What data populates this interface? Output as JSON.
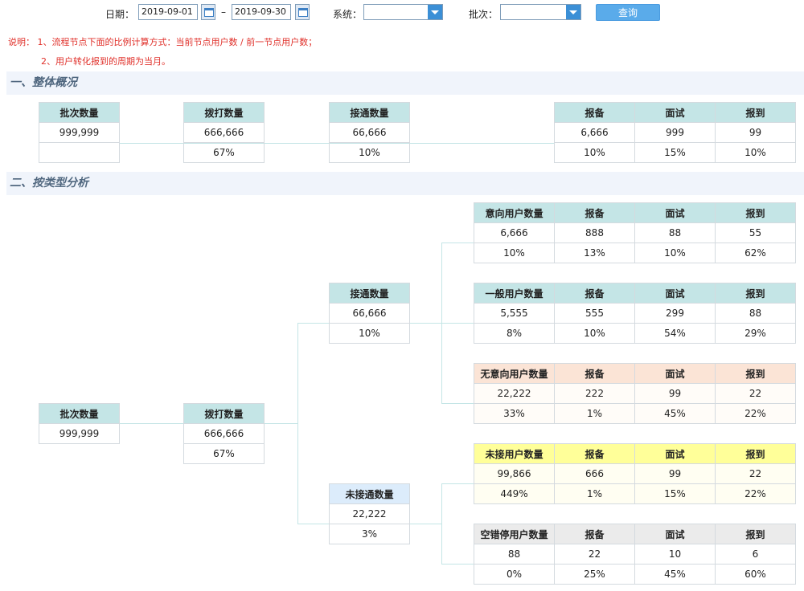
{
  "filter": {
    "date_label": "日期：",
    "date_from": "2019-09-01",
    "date_sep": "–",
    "date_to": "2019-09-30",
    "system_label": "系统：",
    "system_value": "",
    "batch_label": "批次：",
    "batch_value": "",
    "query_button": "查询"
  },
  "notes": {
    "line1": "说明：  1、流程节点下面的比例计算方式：当前节点用户数 / 前一节点用户数；",
    "line2": "2、用户转化报到的周期为当月。"
  },
  "section1": {
    "title": "一、整体概况",
    "batch": {
      "header": "批次数量",
      "value": "999,999",
      "pct": ""
    },
    "dial": {
      "header": "拨打数量",
      "value": "666,666",
      "pct": "67%"
    },
    "connect": {
      "header": "接通数量",
      "value": "66,666",
      "pct": "10%"
    },
    "funnel": {
      "headers": [
        "报备",
        "面试",
        "报到"
      ],
      "values": [
        "6,666",
        "999",
        "99"
      ],
      "pcts": [
        "10%",
        "15%",
        "10%"
      ]
    }
  },
  "section2": {
    "title": "二、按类型分析",
    "batch": {
      "header": "批次数量",
      "value": "999,999"
    },
    "dial": {
      "header": "拨打数量",
      "value": "666,666",
      "pct": "67%"
    },
    "connect": {
      "header": "接通数量",
      "value": "66,666",
      "pct": "10%"
    },
    "not_connect": {
      "header": "未接通数量",
      "value": "22,222",
      "pct": "3%"
    },
    "intent": {
      "headers": [
        "意向用户数量",
        "报备",
        "面试",
        "报到"
      ],
      "values": [
        "6,666",
        "888",
        "88",
        "55"
      ],
      "pcts": [
        "10%",
        "13%",
        "10%",
        "62%"
      ]
    },
    "general": {
      "headers": [
        "一般用户数量",
        "报备",
        "面试",
        "报到"
      ],
      "values": [
        "5,555",
        "555",
        "299",
        "88"
      ],
      "pcts": [
        "8%",
        "10%",
        "54%",
        "29%"
      ]
    },
    "no_intent": {
      "headers": [
        "无意向用户数量",
        "报备",
        "面试",
        "报到"
      ],
      "values": [
        "22,222",
        "222",
        "99",
        "22"
      ],
      "pcts": [
        "33%",
        "1%",
        "45%",
        "22%"
      ]
    },
    "not_answered": {
      "headers": [
        "未接用户数量",
        "报备",
        "面试",
        "报到"
      ],
      "values": [
        "99,866",
        "666",
        "99",
        "22"
      ],
      "pcts": [
        "449%",
        "1%",
        "15%",
        "22%"
      ]
    },
    "wrong_number": {
      "headers": [
        "空错停用户数量",
        "报备",
        "面试",
        "报到"
      ],
      "values": [
        "88",
        "22",
        "10",
        "6"
      ],
      "pcts": [
        "0%",
        "25%",
        "45%",
        "60%"
      ]
    }
  }
}
